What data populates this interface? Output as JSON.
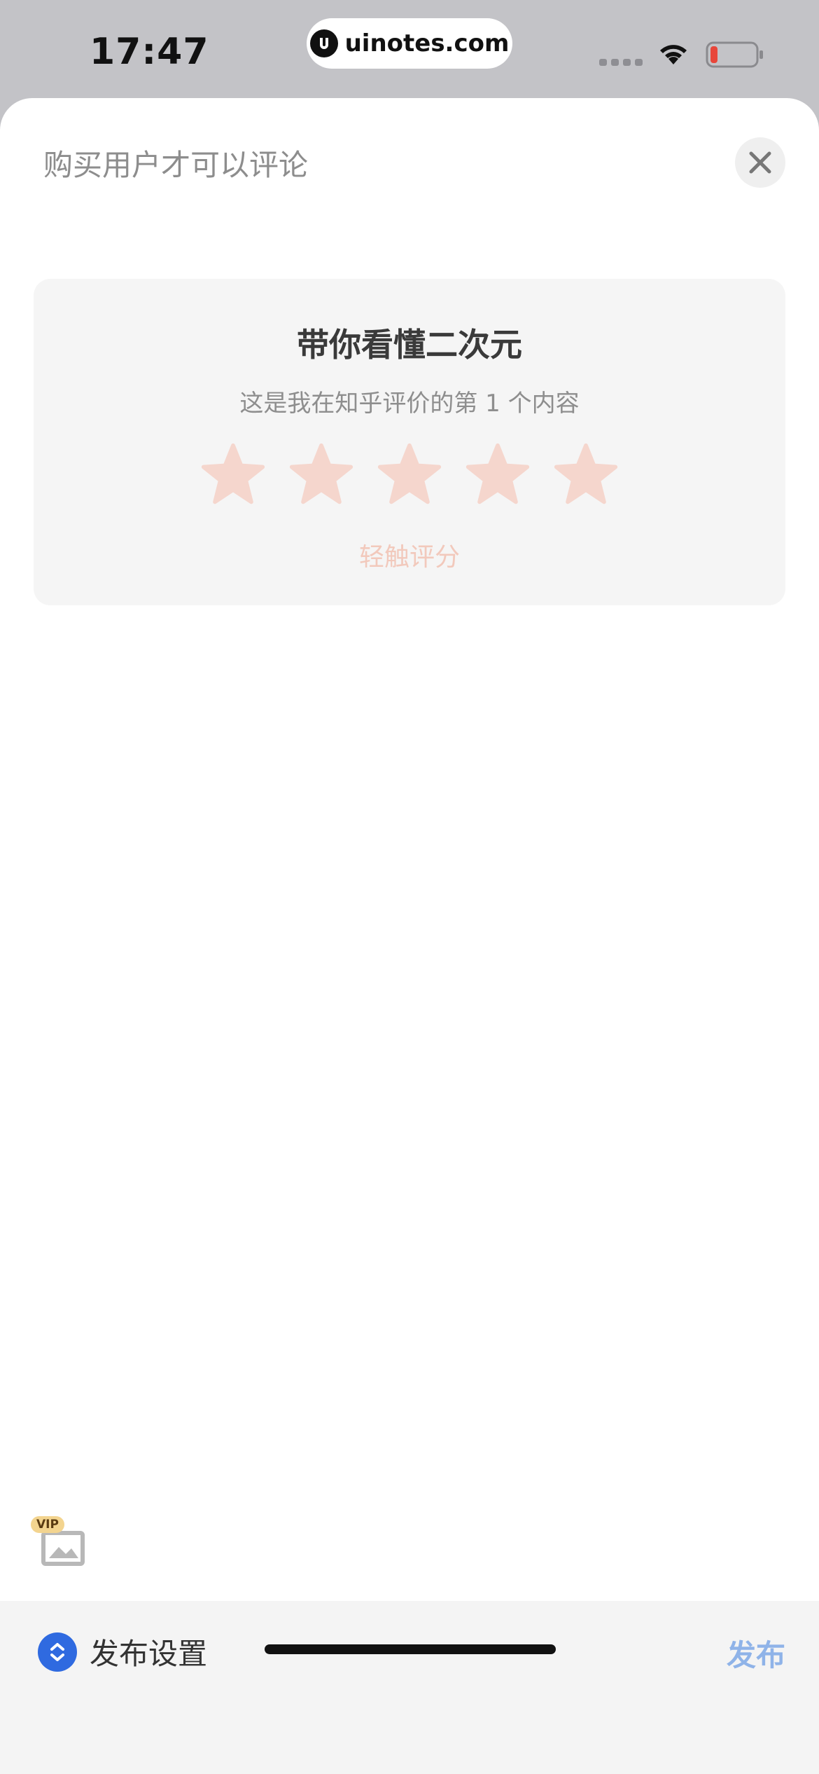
{
  "status_bar": {
    "time": "17:47",
    "url": "uinotes.com",
    "battery_color": "#e8463a"
  },
  "sheet": {
    "title": "购买用户才可以评论",
    "close_icon": "close-icon"
  },
  "rating_card": {
    "title": "带你看懂二次元",
    "subtitle": "这是我在知乎评价的第 1 个内容",
    "star_count": 5,
    "selected_rating": 0,
    "star_color": "#f5d6cd",
    "hint": "轻触评分"
  },
  "toolbar": {
    "vip_badge": "VIP",
    "image_icon": "image-icon"
  },
  "bottom_bar": {
    "settings_label": "发布设置",
    "publish_label": "发布",
    "accent_color": "#2f6ae0",
    "publish_color": "#8fb3e8"
  }
}
